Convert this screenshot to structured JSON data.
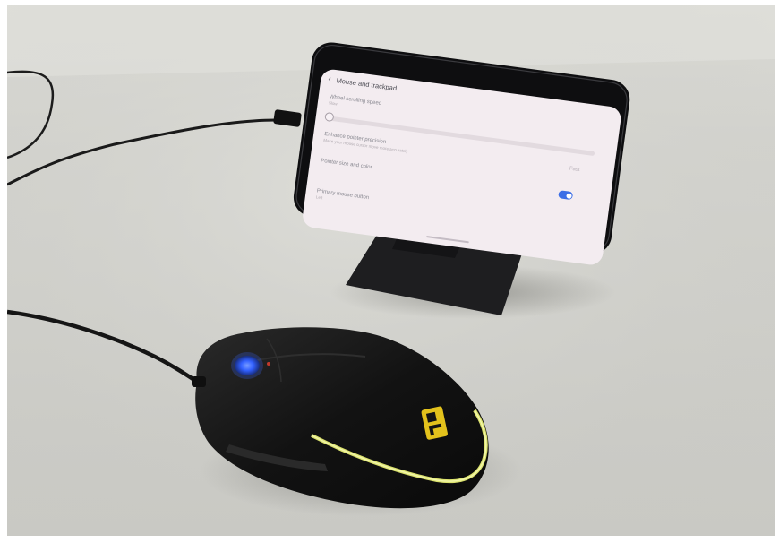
{
  "phone_screen": {
    "title": "Mouse and trackpad",
    "back_icon": "chevron-left-icon",
    "settings": [
      {
        "label": "Wheel scrolling speed",
        "sub": "Slow"
      },
      {
        "label": "Enhance pointer precision",
        "sub": "Make your mouse cursor move more accurately"
      },
      {
        "label": "Pointer size and color",
        "sub": ""
      },
      {
        "label": "Primary mouse button",
        "sub": "Left"
      }
    ],
    "slider_right_label": "Fast",
    "toggle_on": true,
    "colors": {
      "toggle": "#3c6ee6",
      "screen": "#f3ecf0"
    }
  },
  "mouse": {
    "logo": "P",
    "colors": {
      "body": "#141414",
      "rgb_glow": "#e8ef74",
      "scroll_light": "#3a66ff",
      "logo": "#e3c21c"
    }
  }
}
